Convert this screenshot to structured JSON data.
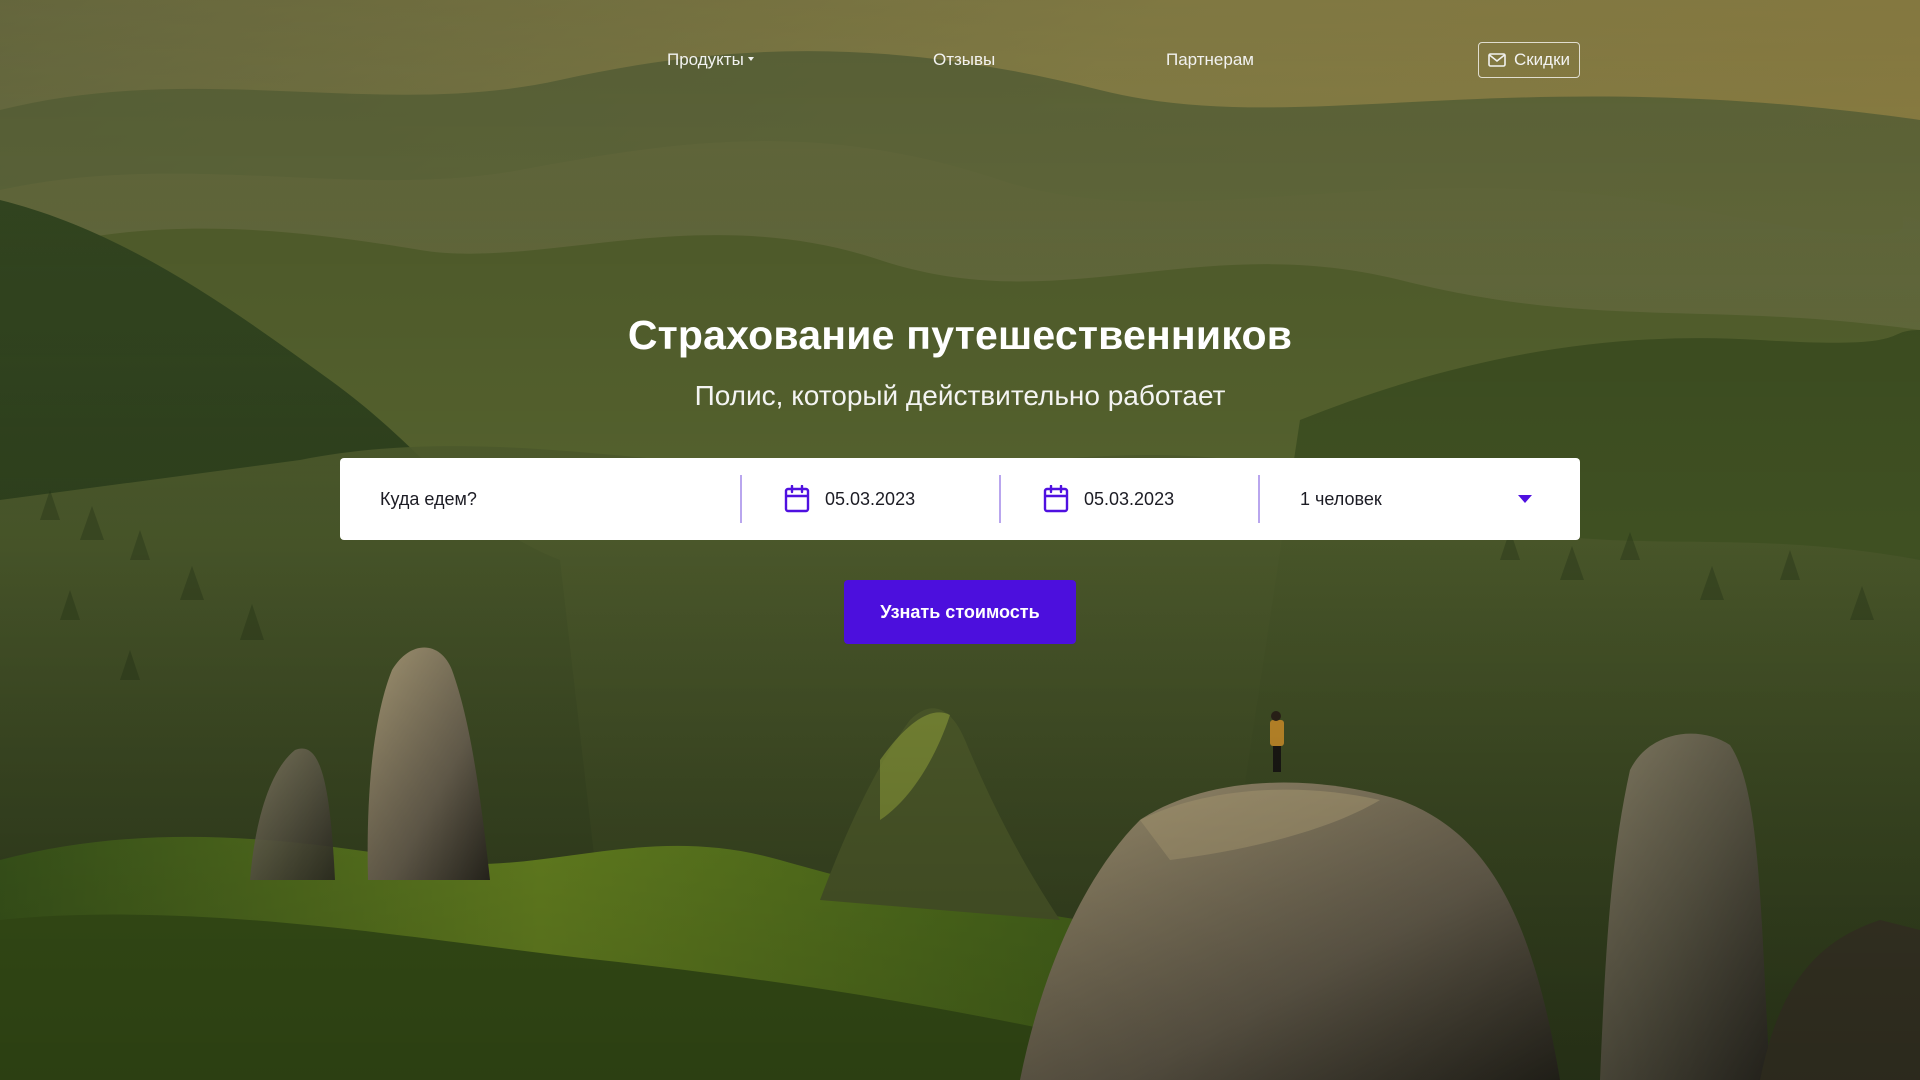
{
  "nav": {
    "products_label": "Продукты",
    "reviews_label": "Отзывы",
    "partners_label": "Партнерам",
    "discounts_label": "Скидки"
  },
  "hero": {
    "title": "Страхование путешественников",
    "subtitle": "Полис, который действительно работает"
  },
  "search": {
    "destination_placeholder": "Куда едем?",
    "date_from": "05.03.2023",
    "date_to": "05.03.2023",
    "travelers": "1 человек"
  },
  "cta": {
    "label": "Узнать стоимость"
  },
  "colors": {
    "accent": "#4c0fdd",
    "divider": "#b9a6ee",
    "icon": "#4f10e0"
  },
  "icons": {
    "discount": "mail-icon",
    "date": "calendar-icon",
    "travelers_dropdown": "caret-down-icon",
    "products_dropdown": "caret-down-icon"
  }
}
